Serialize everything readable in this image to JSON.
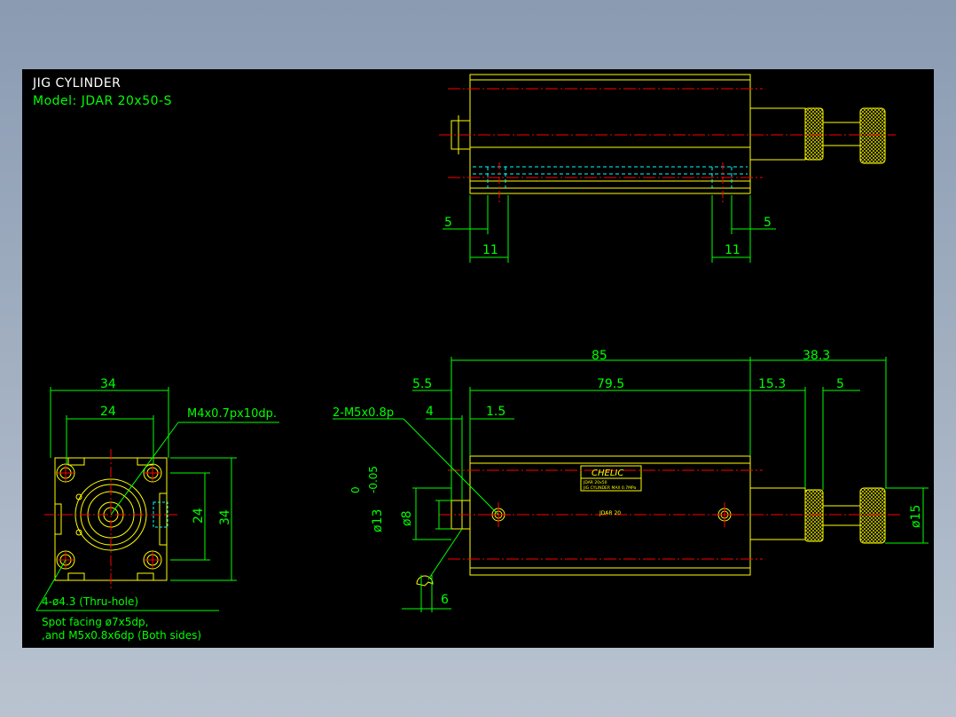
{
  "header": {
    "title": "JIG CYLINDER",
    "model": "Model: JDAR 20x50-S"
  },
  "colors": {
    "background": "#000000",
    "part": "#ffff00",
    "dimension": "#00ff00",
    "centerline": "#ff0000",
    "hidden": "#00ffff",
    "title": "#ffffff",
    "model": "#00ff00",
    "frame": "#8a9bb2"
  },
  "top_view": {
    "dim_left_small": "5",
    "dim_right_small": "5",
    "dim_left_large": "11",
    "dim_right_large": "11"
  },
  "end_view": {
    "dim_width_outer": "34",
    "dim_width_inner": "24",
    "dim_height_inner": "24",
    "dim_height_outer": "34",
    "tap_note": "M4x0.7px10dp.",
    "hole_note": "4-ø4.3 (Thru-hole)",
    "spot_note_1": "Spot facing ø7x5dp,",
    "spot_note_2": ",and M5x0.8x6dp (Both sides)"
  },
  "side_view": {
    "dim_total": "85",
    "dim_ext": "38.3",
    "dim_front": "5.5",
    "dim_body": "79.5",
    "dim_rod": "15.3",
    "dim_knob": "5",
    "dim_4": "4",
    "dim_15": "1.5",
    "port_note": "2-M5x0.8p",
    "dim_rod_dia": "ø13",
    "tol_upper": "0",
    "tol_lower": "-0.05",
    "dim_bore": "ø8",
    "dim_knob_dia": "ø15",
    "dim_6": "6",
    "label_brand": "CHELIC",
    "label_line_1": "JDAR 20x50",
    "label_line_2": "JIG CYLINDER  MAX 0.7MPa",
    "body_marking": "JDAR 20"
  }
}
